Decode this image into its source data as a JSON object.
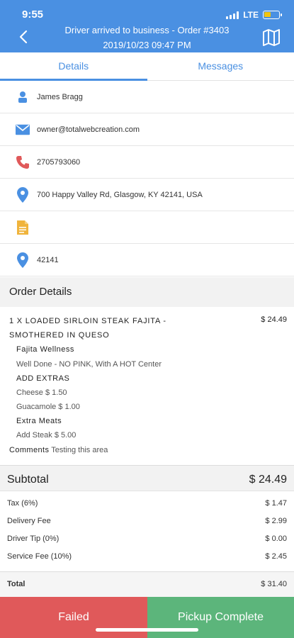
{
  "status": {
    "time": "9:55",
    "network": "LTE"
  },
  "header": {
    "title_line1": "Driver arrived to business - Order #3403",
    "title_line2": "2019/10/23 09:47 PM"
  },
  "tabs": [
    {
      "label": "Details",
      "active": true
    },
    {
      "label": "Messages",
      "active": false
    }
  ],
  "info": {
    "name": "James Bragg",
    "email": "owner@totalwebcreation.com",
    "phone": "2705793060",
    "address": "700 Happy Valley Rd, Glasgow, KY 42141, USA",
    "note": "",
    "zip": "42141"
  },
  "order": {
    "section_title": "Order Details",
    "item_name": "1 X LOADED SIRLOIN STEAK FAJITA - SMOTHERED IN QUESO",
    "item_price": "$ 24.49",
    "lines": [
      "Fajita Wellness",
      "Well Done - NO PINK, With A HOT Center",
      "ADD EXTRAS",
      "Cheese $ 1.50",
      "Guacamole $ 1.00",
      "Extra Meats",
      "Add Steak $ 5.00"
    ],
    "comments_label": "Comments",
    "comments_text": "Testing this area"
  },
  "totals": {
    "subtotal": {
      "label": "Subtotal",
      "value": "$ 24.49"
    },
    "tax": {
      "label": "Tax (6%)",
      "value": "$ 1.47"
    },
    "delivery": {
      "label": "Delivery Fee",
      "value": "$ 2.99"
    },
    "tip": {
      "label": "Driver Tip (0%)",
      "value": "$ 0.00"
    },
    "service": {
      "label": "Service Fee (10%)",
      "value": "$ 2.45"
    },
    "total": {
      "label": "Total",
      "value": "$ 31.40"
    }
  },
  "actions": {
    "failed": "Failed",
    "pickup": "Pickup Complete"
  },
  "colors": {
    "header": "#4a90e2",
    "failed": "#e0595a",
    "pickup": "#5cb57b",
    "icon_blue": "#4a90e2",
    "icon_red": "#e0595a",
    "icon_yellow": "#f0b43c"
  }
}
